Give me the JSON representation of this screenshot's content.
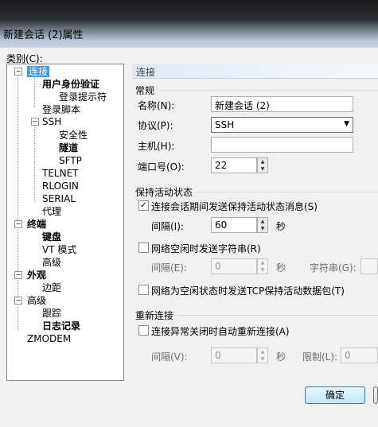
{
  "window": {
    "title": "新建会话 (2)属性"
  },
  "category_label": "类别(C):",
  "tree": {
    "connection": "连接",
    "auth": "用户身份验证",
    "login_prompts": "登录提示符",
    "login_script": "登录脚本",
    "ssh": "SSH",
    "security": "安全性",
    "tunnel": "隧道",
    "sftp": "SFTP",
    "telnet": "TELNET",
    "rlogin": "RLOGIN",
    "serial": "SERIAL",
    "proxy": "代理",
    "terminal": "终端",
    "keyboard": "键盘",
    "vt_mode": "VT 模式",
    "terminal_advanced": "高级",
    "appearance": "外观",
    "margin": "边距",
    "advanced": "高级",
    "trace": "跟踪",
    "logging": "日志记录",
    "zmodem": "ZMODEM"
  },
  "panel": {
    "header": "连接",
    "general_title": "常规",
    "name_label": "名称(N):",
    "name_value": "新建会话 (2)",
    "protocol_label": "协议(P):",
    "protocol_value": "SSH",
    "host_label": "主机(H):",
    "host_value": "",
    "port_label": "端口号(O):",
    "port_value": "22",
    "keepalive_title": "保持活动状态",
    "keepalive_check_label": "连接会话期间发送保持活动状态消息(S)",
    "keepalive_checked": true,
    "interval_label": "间隔(I):",
    "interval_value": "60",
    "seconds": "秒",
    "idle_string_label": "网络空闲时发送字符串(R)",
    "idle_interval_label": "间隔(E):",
    "idle_interval_value": "0",
    "idle_seconds": "秒",
    "string_label": "字符串(G):",
    "tcp_keepalive_label": "网络为空闲状态时发送TCP保持活动数据包(T)",
    "reconnect_title": "重新连接",
    "reconnect_check_label": "连接异常关闭时自动重新连接(A)",
    "reconnect_interval_label": "间隔(V):",
    "reconnect_interval_value": "0",
    "reconnect_seconds": "秒",
    "limit_label": "限制(L):",
    "limit_value": "0"
  },
  "buttons": {
    "ok": "确定"
  }
}
